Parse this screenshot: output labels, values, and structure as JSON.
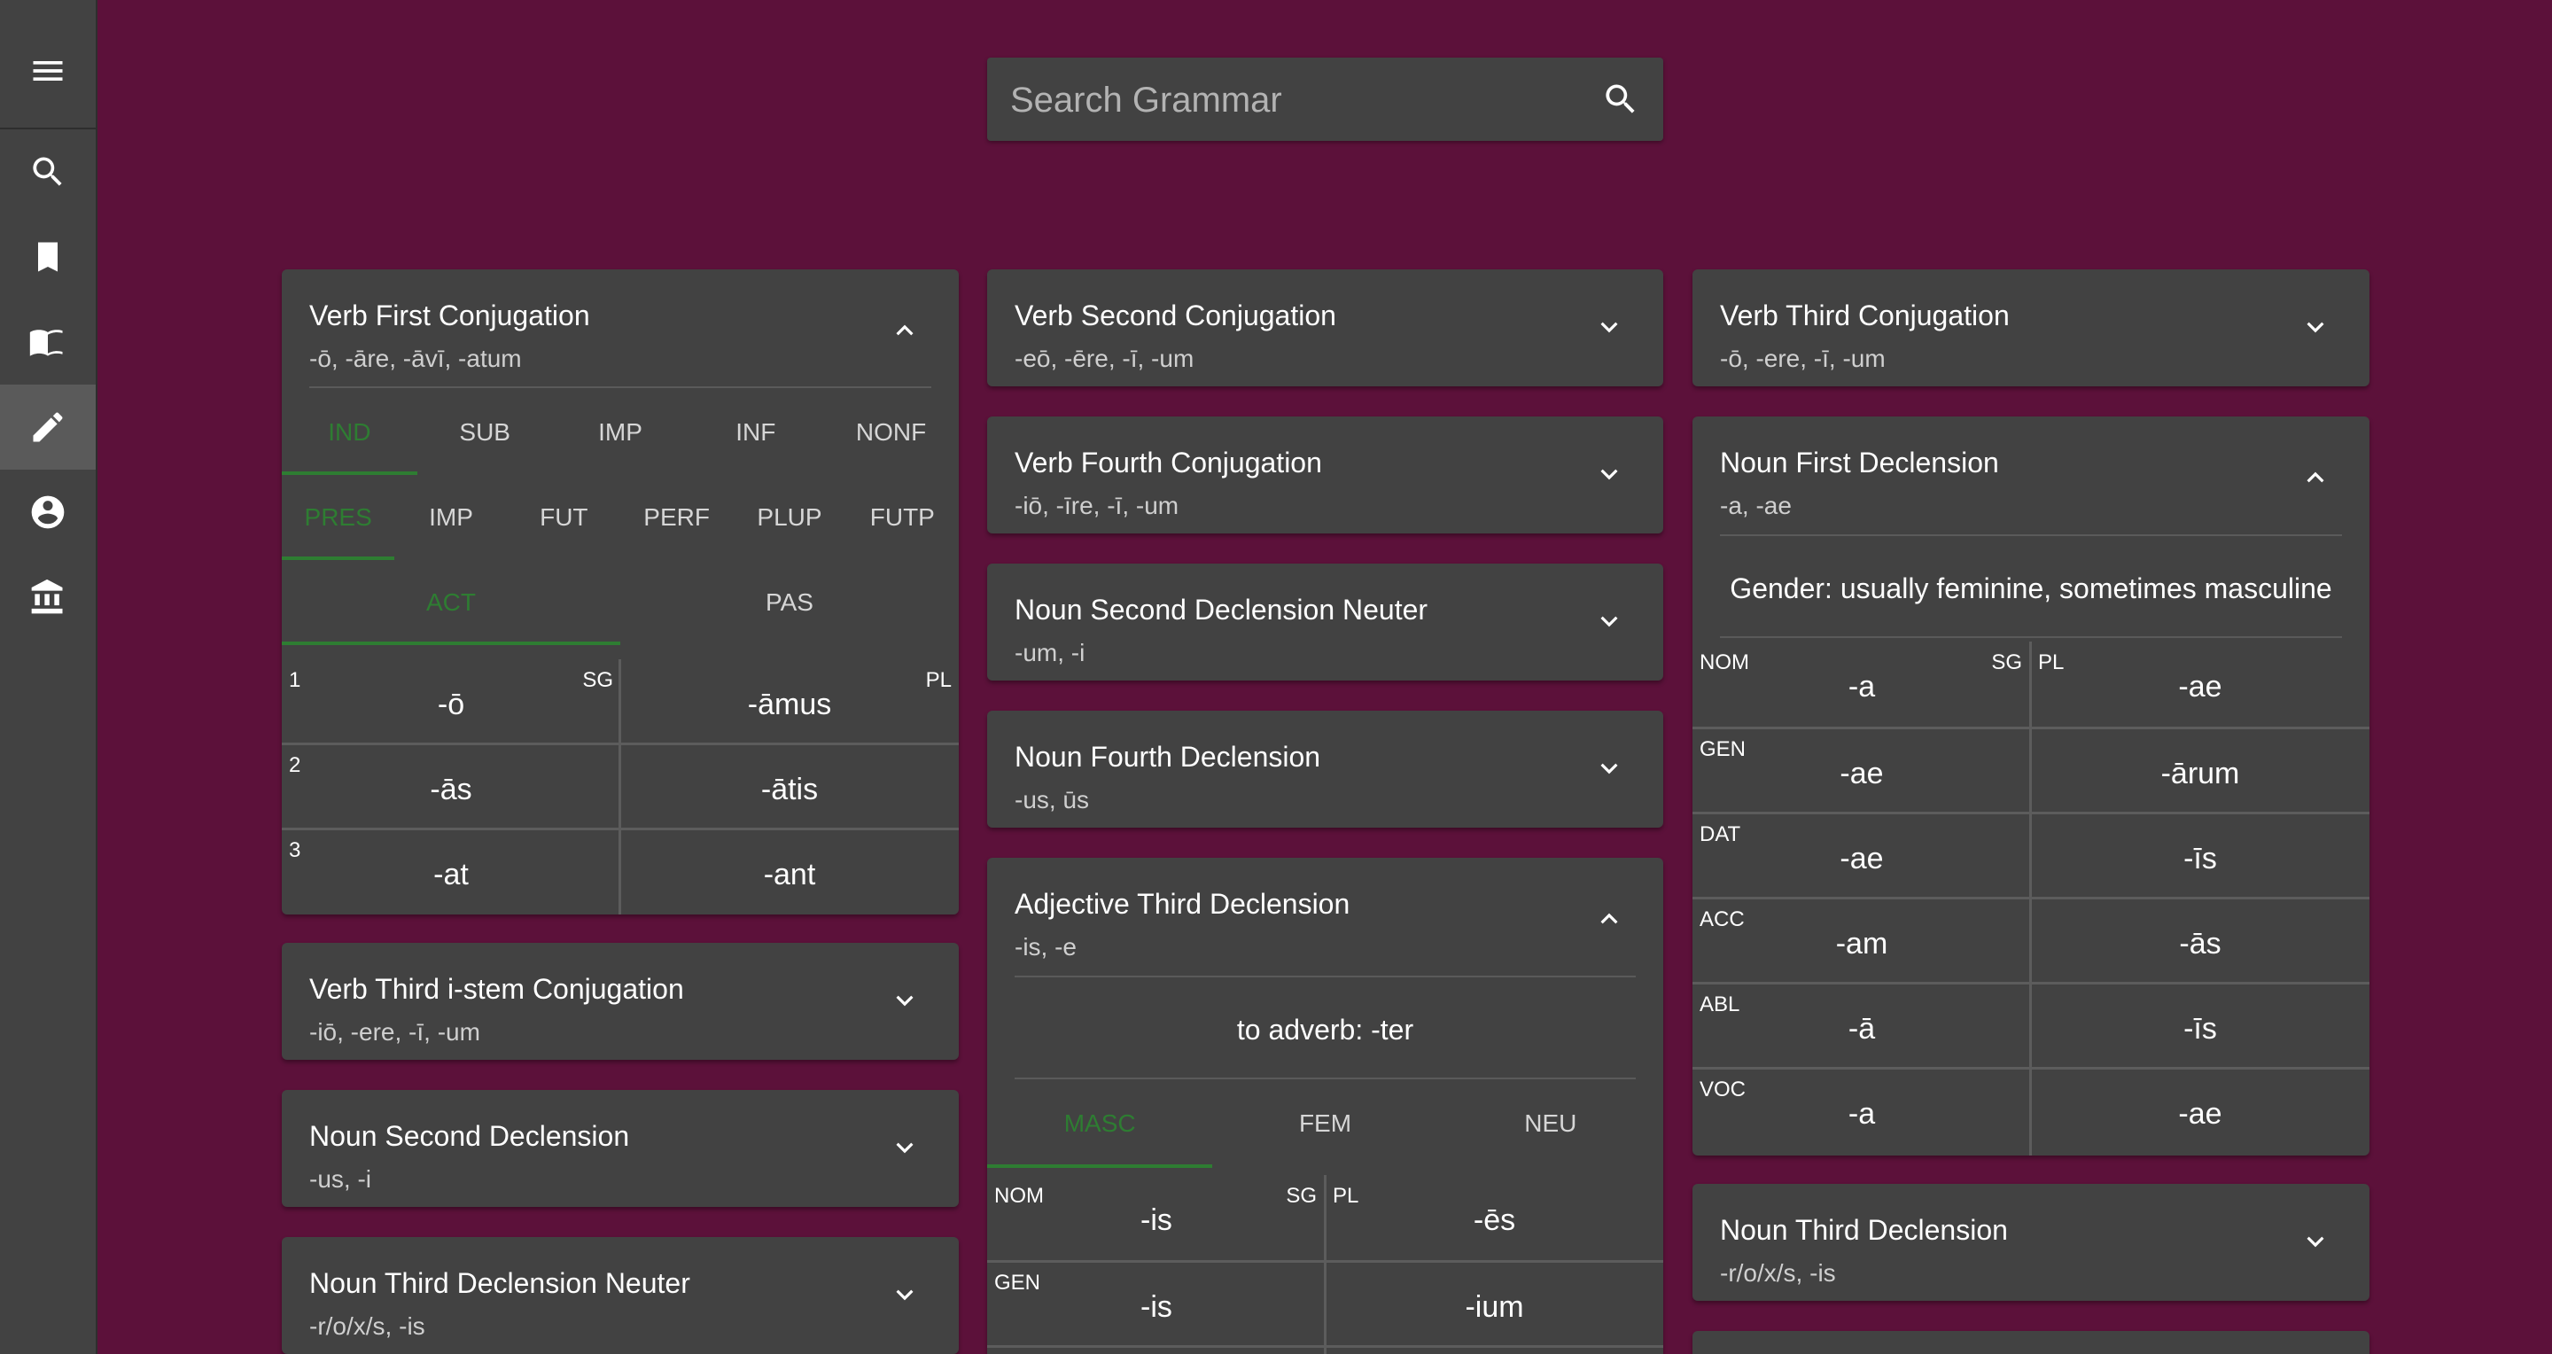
{
  "sidebar": {
    "items": [
      {
        "icon": "menu-icon"
      },
      {
        "icon": "search-icon"
      },
      {
        "icon": "bookmark-icon"
      },
      {
        "icon": "book-icon"
      },
      {
        "icon": "pencil-icon",
        "active": true
      },
      {
        "icon": "account-icon"
      },
      {
        "icon": "bank-icon"
      }
    ]
  },
  "search": {
    "placeholder": "Search Grammar"
  },
  "cards": {
    "v1": {
      "title": "Verb First Conjugation",
      "sub": "-ō, -āre, -āvī, -atum",
      "expanded": true,
      "moods": [
        "IND",
        "SUB",
        "IMP",
        "INF",
        "NONF"
      ],
      "tenses": [
        "PRES",
        "IMP",
        "FUT",
        "PERF",
        "PLUP",
        "FUTP"
      ],
      "voices": [
        "ACT",
        "PAS"
      ],
      "sg_label": "SG",
      "pl_label": "PL",
      "rows": [
        {
          "label": "1",
          "sg": "-ō",
          "pl": "-āmus"
        },
        {
          "label": "2",
          "sg": "-ās",
          "pl": "-ātis"
        },
        {
          "label": "3",
          "sg": "-at",
          "pl": "-ant"
        }
      ]
    },
    "v3i": {
      "title": "Verb Third i-stem Conjugation",
      "sub": "-iō, -ere, -ī, -um"
    },
    "n2": {
      "title": "Noun Second Declension",
      "sub": "-us, -i"
    },
    "n3n": {
      "title": "Noun Third Declension Neuter",
      "sub": "-r/o/x/s, -is"
    },
    "v2": {
      "title": "Verb Second Conjugation",
      "sub": "-eō, -ēre, -ī, -um"
    },
    "v4": {
      "title": "Verb Fourth Conjugation",
      "sub": "-iō, -īre, -ī, -um"
    },
    "n2n": {
      "title": "Noun Second Declension Neuter",
      "sub": "-um, -i"
    },
    "n4": {
      "title": "Noun Fourth Declension",
      "sub": "-us, ūs"
    },
    "a3": {
      "title": "Adjective Third Declension",
      "sub": "-is, -e",
      "expanded": true,
      "note": "to adverb: -ter",
      "genders": [
        "MASC",
        "FEM",
        "NEU"
      ],
      "sg_label": "SG",
      "pl_label": "PL",
      "rows": [
        {
          "label": "NOM",
          "sg": "-is",
          "pl": "-ēs"
        },
        {
          "label": "GEN",
          "sg": "-is",
          "pl": "-ium"
        }
      ]
    },
    "v3": {
      "title": "Verb Third Conjugation",
      "sub": "-ō, -ere, -ī, -um"
    },
    "n1": {
      "title": "Noun First Declension",
      "sub": "-a, -ae",
      "expanded": true,
      "note": "Gender: usually feminine, sometimes masculine",
      "sg_label": "SG",
      "pl_label": "PL",
      "rows": [
        {
          "label": "NOM",
          "sg": "-a",
          "pl": "-ae"
        },
        {
          "label": "GEN",
          "sg": "-ae",
          "pl": "-ārum"
        },
        {
          "label": "DAT",
          "sg": "-ae",
          "pl": "-īs"
        },
        {
          "label": "ACC",
          "sg": "-am",
          "pl": "-ās"
        },
        {
          "label": "ABL",
          "sg": "-ā",
          "pl": "-īs"
        },
        {
          "label": "VOC",
          "sg": "-a",
          "pl": "-ae"
        }
      ]
    },
    "n3": {
      "title": "Noun Third Declension",
      "sub": "-r/o/x/s, -is"
    }
  },
  "colors": {
    "background": "#5c113a",
    "card": "#424242",
    "sidebar": "#424242",
    "active_tab": "#2e7d32"
  }
}
